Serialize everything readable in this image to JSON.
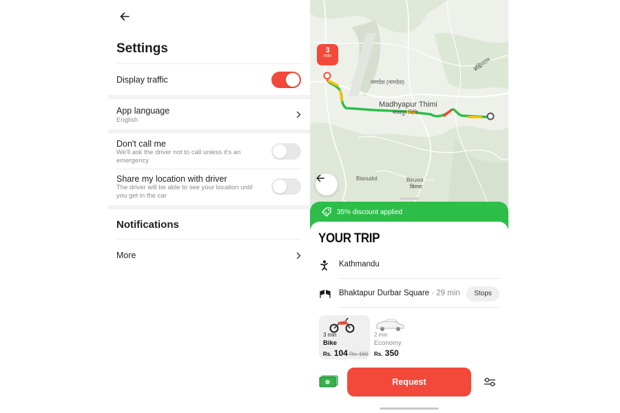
{
  "settings": {
    "title": "Settings",
    "display_traffic": {
      "label": "Display traffic",
      "enabled": true
    },
    "app_language": {
      "label": "App language",
      "value": "English"
    },
    "dont_call_me": {
      "label": "Don't call me",
      "description": "We'll ask the driver not to call unless it's an emergency",
      "enabled": false
    },
    "share_location": {
      "label": "Share my location with driver",
      "description": "The driver will be able to see your location until you get in the car",
      "enabled": false
    },
    "notifications_title": "Notifications",
    "more_label": "More"
  },
  "map": {
    "eta_value": "3",
    "eta_unit": "min",
    "labels": {
      "nagdesh": "नागदेश (नागदेश)",
      "madhyapur_en": "Madhyapur Thimi",
      "madhyapur_ne": "मध्यपुर थिमि",
      "bisnudol": "Bisnudol",
      "biruwa_en": "Biruwa",
      "biruwa_ne": "बिरुवा",
      "top_right": "ब्रह्मिनटार"
    },
    "route_colors": {
      "free": "#2dbe4a",
      "moderate": "#f5c200",
      "heavy": "#f2493a"
    }
  },
  "trip": {
    "discount_text": "35% discount applied",
    "title": "YOUR TRIP",
    "origin": "Kathmandu",
    "destination": "Bhaktapur Durbar Square",
    "destination_duration": "· 29 min",
    "stops_label": "Stops",
    "tariffs": [
      {
        "time": "3 min",
        "name": "Bike",
        "currency": "Rs.",
        "price": "104",
        "old_price": "Rs. 160",
        "selected": true,
        "icon": "motorbike-icon"
      },
      {
        "time": "2 min",
        "name": "Economy",
        "currency": "Rs.",
        "price": "350",
        "old_price": "",
        "selected": false,
        "icon": "car-icon"
      }
    ],
    "request_label": "Request",
    "payment_icon": "cash-icon",
    "options_icon": "sliders-icon"
  },
  "colors": {
    "accent": "#f2493a",
    "discount_green": "#2dbe4a",
    "muted_text": "#8a8a8a"
  }
}
